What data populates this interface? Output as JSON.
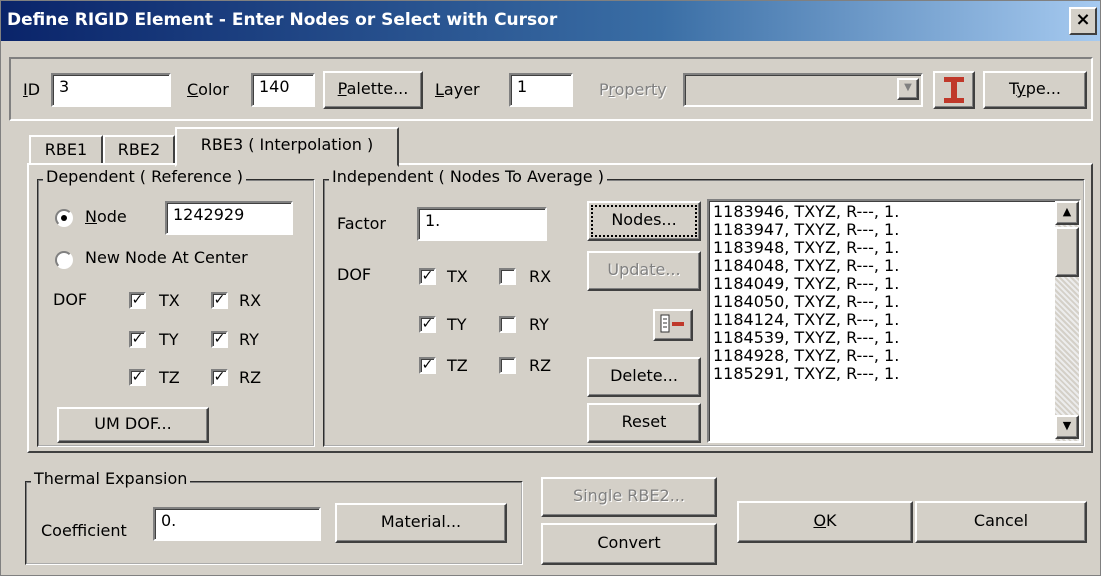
{
  "window": {
    "title": "Define RIGID Element - Enter Nodes or Select with Cursor",
    "close": "×"
  },
  "header": {
    "id_label": "ID",
    "id_value": "3",
    "color_label": "Color",
    "color_value": "140",
    "palette_label": "Palette...",
    "layer_label": "Layer",
    "layer_value": "1",
    "property_label": "Property",
    "property_value": "",
    "type_label": "Type..."
  },
  "tabs": [
    {
      "label": "RBE1"
    },
    {
      "label": "RBE2"
    },
    {
      "label": "RBE3 ( Interpolation )"
    }
  ],
  "dependent": {
    "legend": "Dependent ( Reference )",
    "node_label": "Node",
    "node_value": "1242929",
    "node_selected": true,
    "new_node_label": "New Node At Center",
    "dof_label": "DOF",
    "dofs": [
      {
        "label": "TX",
        "checked": true
      },
      {
        "label": "RX",
        "checked": true
      },
      {
        "label": "TY",
        "checked": true
      },
      {
        "label": "RY",
        "checked": true
      },
      {
        "label": "TZ",
        "checked": true
      },
      {
        "label": "RZ",
        "checked": true
      }
    ],
    "um_dof_label": "UM DOF..."
  },
  "independent": {
    "legend": "Independent ( Nodes To Average )",
    "factor_label": "Factor",
    "factor_value": "1.",
    "dof_label": "DOF",
    "dofs": [
      {
        "label": "TX",
        "checked": true
      },
      {
        "label": "RX",
        "checked": false
      },
      {
        "label": "TY",
        "checked": true
      },
      {
        "label": "RY",
        "checked": false
      },
      {
        "label": "TZ",
        "checked": true
      },
      {
        "label": "RZ",
        "checked": false
      }
    ],
    "nodes_label": "Nodes...",
    "update_label": "Update...",
    "delete_label": "Delete...",
    "reset_label": "Reset",
    "list": [
      "1183946, TXYZ, R---, 1.",
      "1183947, TXYZ, R---, 1.",
      "1183948, TXYZ, R---, 1.",
      "1184048, TXYZ, R---, 1.",
      "1184049, TXYZ, R---, 1.",
      "1184050, TXYZ, R---, 1.",
      "1184124, TXYZ, R---, 1.",
      "1184539, TXYZ, R---, 1.",
      "1184928, TXYZ, R---, 1.",
      "1185291, TXYZ, R---, 1."
    ]
  },
  "thermal": {
    "legend": "Thermal Expansion",
    "coefficient_label": "Coefficient",
    "coefficient_value": "0.",
    "material_label": "Material..."
  },
  "footer": {
    "single_rbe2_label": "Single RBE2...",
    "convert_label": "Convert",
    "ok_label": "OK",
    "cancel_label": "Cancel"
  },
  "colors": {
    "title_start": "#0a246a",
    "title_end": "#a6caf0",
    "face": "#d4d0c8",
    "icon_red": "#c0392b"
  }
}
